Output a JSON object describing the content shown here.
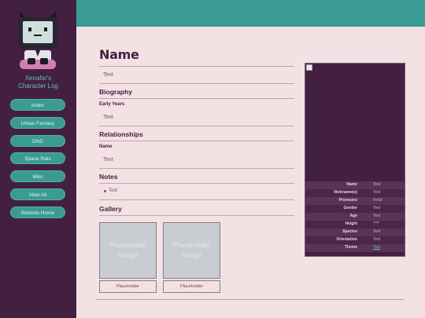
{
  "colors": {
    "sidebar": "#432042",
    "topbar": "#3a9b93",
    "background": "#f3e1e4",
    "accent": "#5fc2b4"
  },
  "site": {
    "title_line1": "Xenafar's",
    "title_line2": "Character Log"
  },
  "nav": [
    {
      "label": "Index"
    },
    {
      "label": "Urban Fantasy"
    },
    {
      "label": "DND"
    },
    {
      "label": "Space Rats"
    },
    {
      "label": "Misc"
    },
    {
      "label": "View All"
    },
    {
      "label": "Website Home"
    }
  ],
  "profile": {
    "name": "Name",
    "intro": "Text",
    "biography": {
      "heading": "Biography",
      "subheading": "Early Years",
      "text": "Text"
    },
    "relationships": {
      "heading": "Relationships",
      "subheading": "Name",
      "text": "Text"
    },
    "notes": {
      "heading": "Notes",
      "items": [
        "Text"
      ]
    },
    "gallery": {
      "heading": "Gallery",
      "items": [
        {
          "image_line1": "Placeholder",
          "image_line2": "Image",
          "caption": "Placeholder"
        },
        {
          "image_line1": "Placeholder",
          "image_line2": "Image",
          "caption": "Placeholder"
        }
      ]
    }
  },
  "infobox": {
    "rows": [
      {
        "key": "Name",
        "value": "Text"
      },
      {
        "key": "Nickname(s)",
        "value": "Text"
      },
      {
        "key": "Pronouns",
        "value": "Fe/ut"
      },
      {
        "key": "Gender",
        "value": "Text"
      },
      {
        "key": "Age",
        "value": "Text"
      },
      {
        "key": "Height",
        "value": "?'?\""
      },
      {
        "key": "Species",
        "value": "Text"
      },
      {
        "key": "Orientation",
        "value": "Text"
      },
      {
        "key": "Theme",
        "value": "Text"
      }
    ]
  }
}
